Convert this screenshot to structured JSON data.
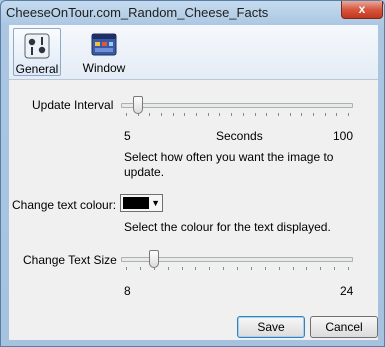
{
  "window": {
    "title": "CheeseOnTour.com_Random_Cheese_Facts",
    "close_glyph": "x"
  },
  "toolbar": {
    "items": [
      {
        "label": "General",
        "icon": "general-settings-icon",
        "selected": true
      },
      {
        "label": "Window",
        "icon": "window-icon",
        "selected": false
      }
    ]
  },
  "update_interval": {
    "label": "Update Interval",
    "min_label": "5",
    "unit_label": "Seconds",
    "max_label": "100",
    "min": 5,
    "max": 100,
    "value": 10,
    "help": "Select how often you want the image to update."
  },
  "text_colour": {
    "label": "Change text colour:",
    "value": "#000000",
    "help": "Select the colour for the text displayed."
  },
  "text_size": {
    "label": "Change Text Size",
    "min_label": "8",
    "max_label": "24",
    "min": 8,
    "max": 24,
    "value": 10
  },
  "buttons": {
    "save": "Save",
    "cancel": "Cancel"
  }
}
